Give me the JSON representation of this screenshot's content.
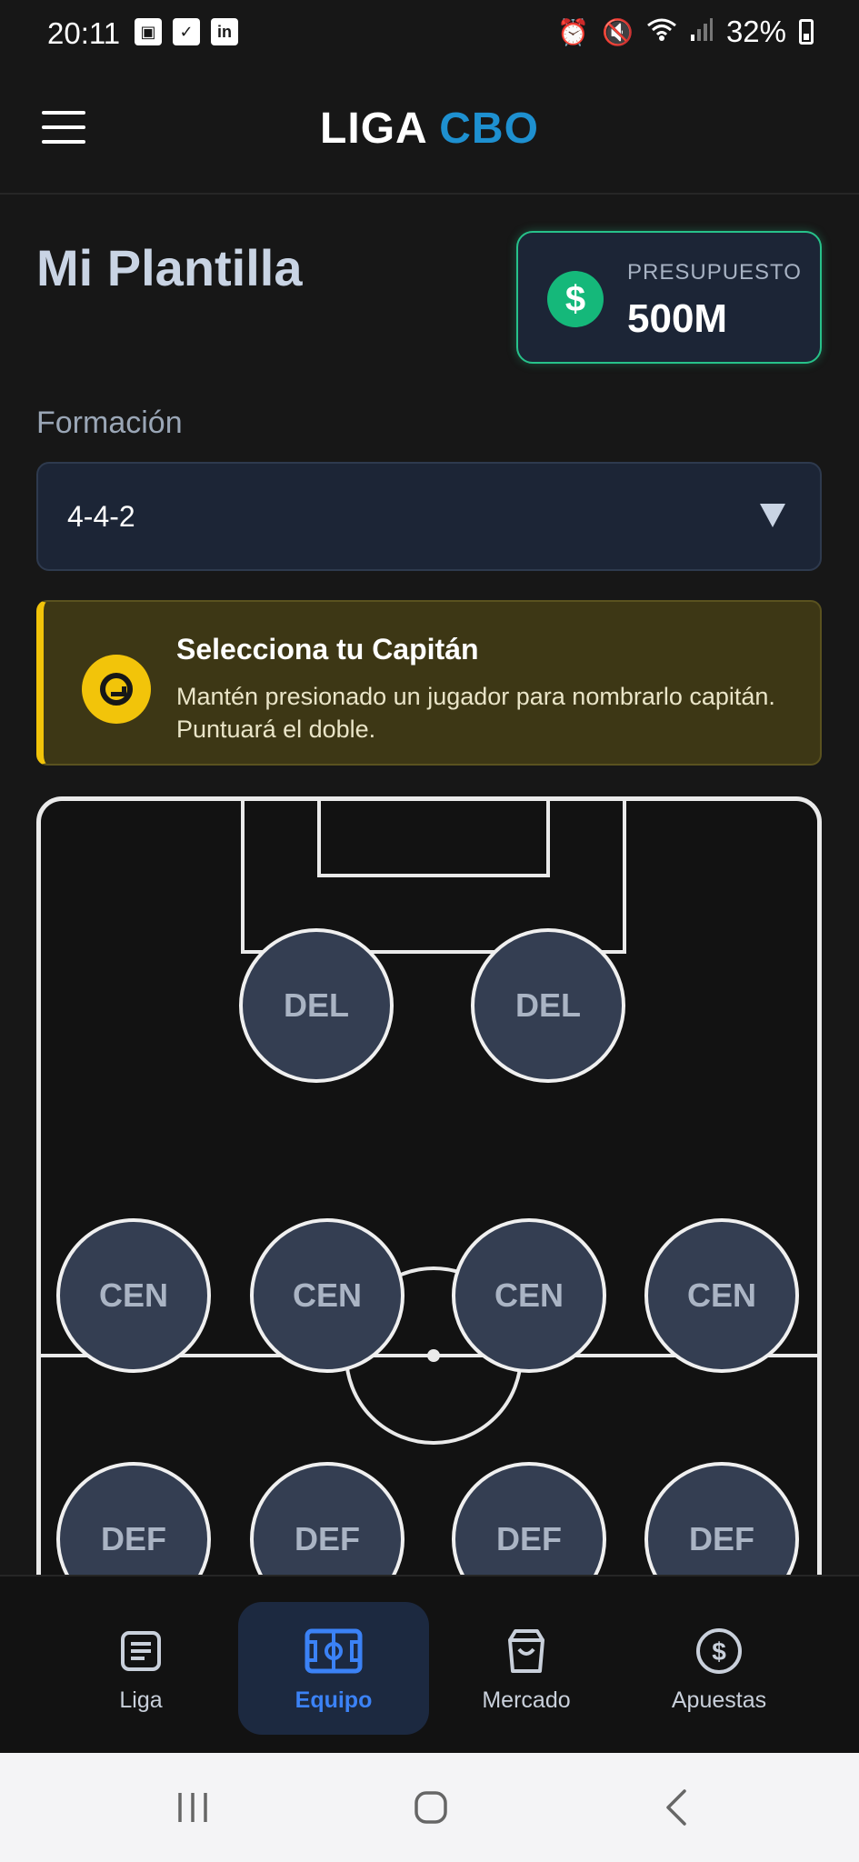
{
  "status_bar": {
    "time": "20:11",
    "left_icons": [
      "image-icon",
      "checkbox-icon",
      "linkedin-icon"
    ],
    "right_icons": [
      "alarm-icon",
      "mute-icon",
      "wifi-icon",
      "signal-icon"
    ],
    "battery": "32%"
  },
  "header": {
    "title_part1": "LIGA",
    "title_part2": "CBO",
    "accent_color": "#1e90d0",
    "menu_icon": "hamburger-icon"
  },
  "page": {
    "title": "Mi Plantilla"
  },
  "budget": {
    "label": "PRESUPUESTO",
    "value": "500M",
    "icon": "dollar-icon",
    "icon_glyph": "$",
    "accent_color": "#27c28a"
  },
  "formation": {
    "label": "Formación",
    "value": "4-4-2"
  },
  "captain": {
    "title": "Selecciona tu Capitán",
    "text": "Mantén presionado un jugador para nombrarlo capitán. Puntuará el doble.",
    "accent_color": "#f2c40a"
  },
  "pitch": {
    "forwards": [
      "DEL",
      "DEL"
    ],
    "midfielders": [
      "CEN",
      "CEN",
      "CEN",
      "CEN"
    ],
    "defenders": [
      "DEF",
      "DEF",
      "DEF",
      "DEF"
    ]
  },
  "bottom_nav": {
    "items": [
      {
        "label": "Liga",
        "icon": "news-icon",
        "active": false
      },
      {
        "label": "Equipo",
        "icon": "pitch-icon",
        "active": true
      },
      {
        "label": "Mercado",
        "icon": "shopping-bag-icon",
        "active": false
      },
      {
        "label": "Apuestas",
        "icon": "coin-icon",
        "active": false
      }
    ],
    "active_color": "#3b82f6"
  }
}
